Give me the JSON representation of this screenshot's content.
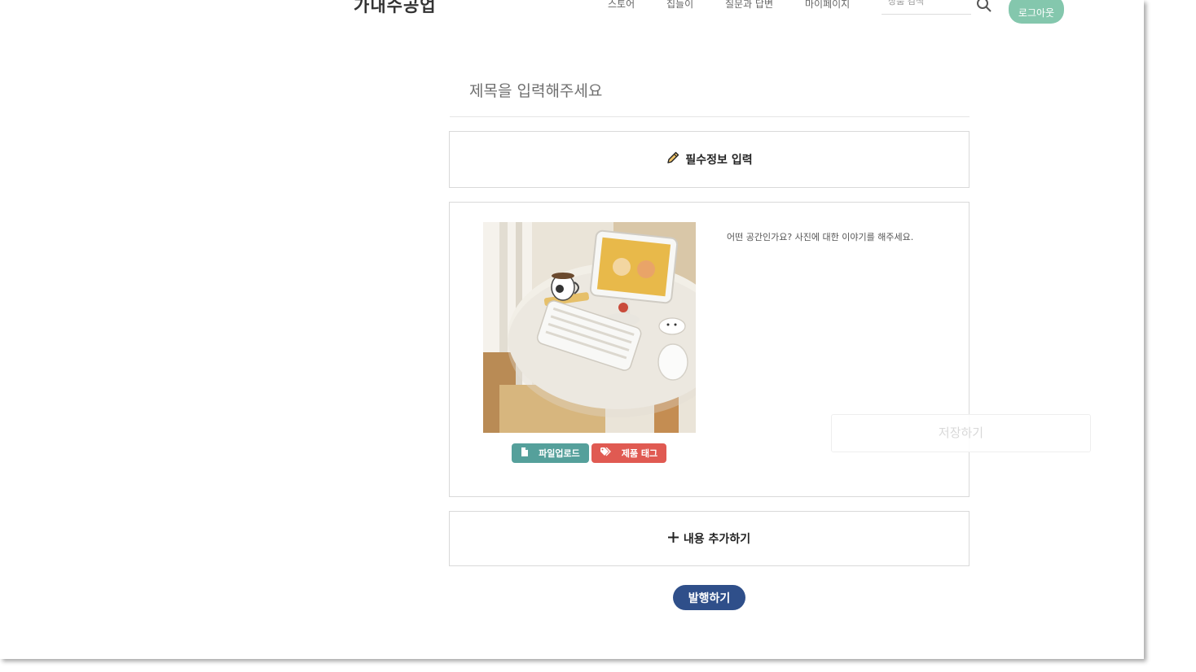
{
  "nav": {
    "logo": "가내수공업",
    "links": [
      "스토어",
      "집들이",
      "질문과 답변",
      "마이페이지"
    ],
    "search_placeholder": "상품 검색",
    "login_label": "로그아웃"
  },
  "editor": {
    "title_placeholder": "제목을 입력해주세요",
    "required_info_label": "필수정보 입력",
    "description_placeholder": "어떤 공간인가요? 사진에 대한 이야기를 해주세요.",
    "upload_label": "파일업로드",
    "tag_label": "제품 태그",
    "add_content_label": "내용 추가하기",
    "save_label": "저장하기",
    "publish_label": "발행하기"
  },
  "colors": {
    "upload": "#55a09b",
    "tag": "#e05a52",
    "publish": "#2f4f8a",
    "login": "#84c7ad"
  },
  "icons": {
    "required": "pencil-icon",
    "upload": "file-icon",
    "tag": "tag-icon",
    "add": "plus-icon",
    "search": "search-icon"
  }
}
